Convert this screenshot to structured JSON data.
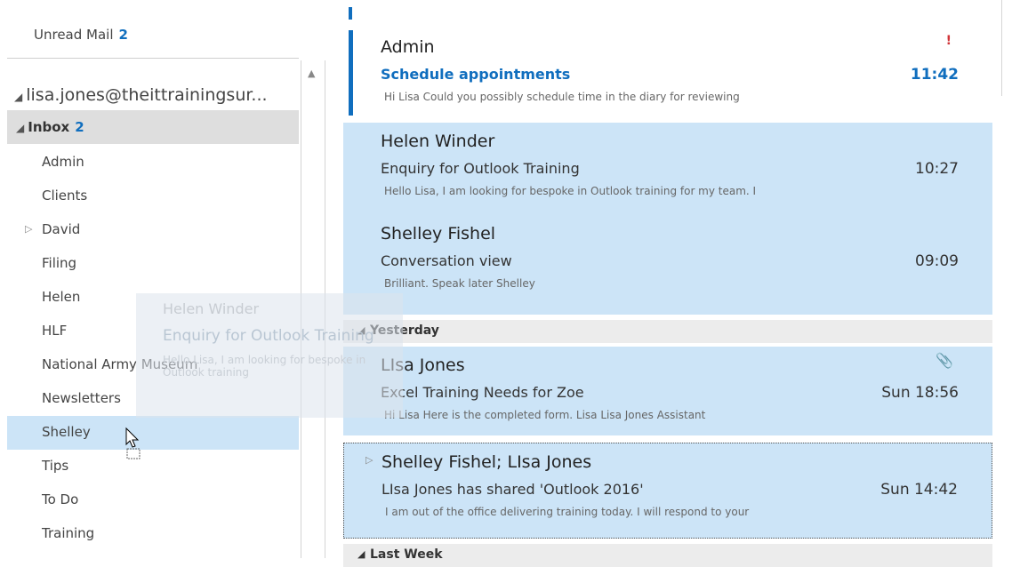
{
  "colors": {
    "accent": "#106ebe",
    "selection": "#cce4f7",
    "flag": "#d13438",
    "hover": "#dedede"
  },
  "folder_pane": {
    "unread_mail": {
      "label": "Unread Mail",
      "count": "2"
    },
    "account": "lisa.jones@theittrainingsur...",
    "inbox": {
      "label": "Inbox",
      "count": "2"
    },
    "folders": [
      {
        "label": "Admin"
      },
      {
        "label": "Clients"
      },
      {
        "label": "David"
      },
      {
        "label": "Filing"
      },
      {
        "label": "Helen"
      },
      {
        "label": "HLF"
      },
      {
        "label": "National Army Museum"
      },
      {
        "label": "Newsletters"
      },
      {
        "label": "Shelley"
      },
      {
        "label": "Tips"
      },
      {
        "label": "To Do"
      },
      {
        "label": "Training"
      }
    ]
  },
  "drag_ghost": {
    "from": "Helen Winder",
    "subject": "Enquiry for Outlook Training",
    "preview": "Hello Lisa, I am looking for bespoke in Outlook training"
  },
  "message_list": {
    "messages": [
      {
        "from": "Admin",
        "subject": "Schedule appointments",
        "time": "11:42",
        "preview": "Hi Lisa Could you possibly schedule time in the diary for reviewing",
        "flag": "!"
      },
      {
        "from": "Helen Winder",
        "subject": "Enquiry for Outlook Training",
        "time": "10:27",
        "preview": "Hello Lisa, I am looking for bespoke in Outlook training for my team. I"
      },
      {
        "from": "Shelley Fishel",
        "subject": "Conversation view",
        "time": "09:09",
        "preview": "Brilliant. Speak later Shelley"
      },
      {
        "from": "LIsa Jones",
        "subject": "Excel Training Needs for Zoe",
        "time": "Sun 18:56",
        "preview": "Hi Lisa Here is the completed form. Lisa Lisa Jones Assistant"
      },
      {
        "from": "Shelley Fishel; LIsa Jones",
        "subject": "LIsa Jones has shared 'Outlook 2016'",
        "time": "Sun 14:42",
        "preview": "I am out of the office delivering training today. I will respond to your"
      }
    ],
    "groups": {
      "yesterday": "Yesterday",
      "last_week": "Last Week"
    }
  }
}
